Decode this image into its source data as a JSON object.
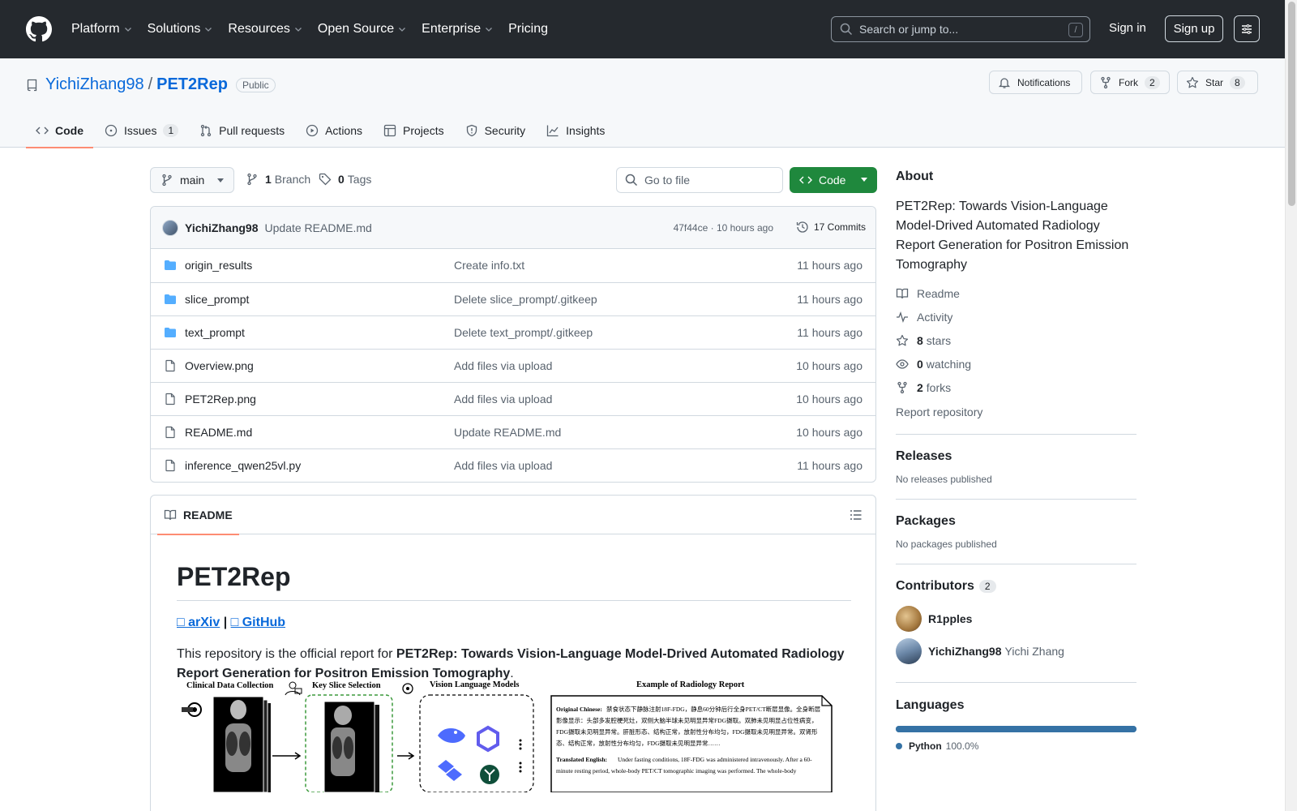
{
  "header": {
    "nav": [
      "Platform",
      "Solutions",
      "Resources",
      "Open Source",
      "Enterprise",
      "Pricing"
    ],
    "search_placeholder": "Search or jump to...",
    "search_shortcut": "/",
    "signin": "Sign in",
    "signup": "Sign up"
  },
  "repo": {
    "owner": "YichiZhang98",
    "sep": "/",
    "name": "PET2Rep",
    "visibility": "Public",
    "notifications": "Notifications",
    "fork_label": "Fork",
    "fork_count": "2",
    "star_label": "Star",
    "star_count": "8"
  },
  "tabs": {
    "code": "Code",
    "issues": "Issues",
    "issues_count": "1",
    "pulls": "Pull requests",
    "actions": "Actions",
    "projects": "Projects",
    "security": "Security",
    "insights": "Insights"
  },
  "toolbar": {
    "branch": "main",
    "branch_count": "1",
    "branch_label": "Branch",
    "tag_count": "0",
    "tag_label": "Tags",
    "goto_placeholder": "Go to file",
    "code_button": "Code"
  },
  "commit": {
    "author": "YichiZhang98",
    "message": "Update README.md",
    "meta": "47f44ce · 10 hours ago",
    "commits": "17 Commits"
  },
  "files": [
    {
      "type": "dir",
      "name": "origin_results",
      "msg": "Create info.txt",
      "time": "11 hours ago"
    },
    {
      "type": "dir",
      "name": "slice_prompt",
      "msg": "Delete slice_prompt/.gitkeep",
      "time": "11 hours ago"
    },
    {
      "type": "dir",
      "name": "text_prompt",
      "msg": "Delete text_prompt/.gitkeep",
      "time": "11 hours ago"
    },
    {
      "type": "file",
      "name": "Overview.png",
      "msg": "Add files via upload",
      "time": "10 hours ago"
    },
    {
      "type": "file",
      "name": "PET2Rep.png",
      "msg": "Add files via upload",
      "time": "10 hours ago"
    },
    {
      "type": "file",
      "name": "README.md",
      "msg": "Update README.md",
      "time": "10 hours ago"
    },
    {
      "type": "file",
      "name": "inference_qwen25vl.py",
      "msg": "Add files via upload",
      "time": "11 hours ago"
    }
  ],
  "readme": {
    "tab": "README",
    "title": "PET2Rep",
    "link_arxiv": "□ arXiv",
    "link_sep": " | ",
    "link_github": "□ GitHub",
    "intro_prefix": "This repository is the official report for ",
    "intro_bold": "PET2Rep: Towards Vision-Language Model-Drived Automated Radiology Report Generation for Positron Emission Tomography",
    "intro_suffix": ".",
    "figure": {
      "col1": "Clinical Data Collection",
      "col2": "Key Slice Selection",
      "col3": "Vision Language Models",
      "col4": "Example of Radiology Report",
      "orig_label": "Original Chinese:",
      "orig_text_1": "禁食状态下静脉注射18F-FDG，静息60分钟后行全身PET/CT断层显像。全身断层",
      "orig_text_2": "影像显示：头部多发腔梗死灶，双侧大脑半球未见明显异常FDG摄取。双肺未见明显占位性病变，",
      "orig_text_3": "FDG摄取未见明显异常。肝脏形态、结构正常，放射性分布均匀，FDG摄取未见明显异常。双肾形",
      "orig_text_4": "态、结构正常，放射性分布均匀，FDG摄取未见明显异常……",
      "trans_label": "Translated English:",
      "trans_text_1": "Under fasting conditions, 18F-FDG was administered intravenously. After a 60-",
      "trans_text_2": "minute resting period, whole-body PET/CT tomographic imaging was performed. The whole-body"
    }
  },
  "about": {
    "heading": "About",
    "description": "PET2Rep: Towards Vision-Language Model-Drived Automated Radiology Report Generation for Positron Emission Tomography",
    "readme": "Readme",
    "activity": "Activity",
    "stars_num": "8",
    "stars_label": "stars",
    "watching_num": "0",
    "watching_label": "watching",
    "forks_num": "2",
    "forks_label": "forks",
    "report": "Report repository"
  },
  "releases": {
    "heading": "Releases",
    "sub": "No releases published"
  },
  "packages": {
    "heading": "Packages",
    "sub": "No packages published"
  },
  "contributors": {
    "heading": "Contributors",
    "count": "2",
    "list": [
      {
        "login": "R1pples",
        "full": ""
      },
      {
        "login": "YichiZhang98",
        "full": "Yichi Zhang"
      }
    ]
  },
  "languages": {
    "heading": "Languages",
    "items": [
      {
        "name": "Python",
        "percent": "100.0%",
        "fraction": 1.0,
        "color": "#3572A5"
      }
    ]
  },
  "colors": {
    "header_bg": "#25292e",
    "link": "#0969da",
    "primary_button": "#1f883d",
    "tab_underline": "#fd8c73"
  }
}
